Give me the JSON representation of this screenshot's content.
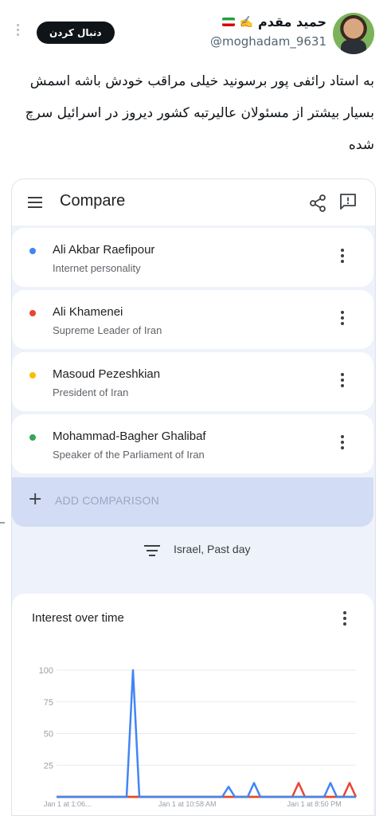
{
  "tweet": {
    "display_name": "حمید مقدم",
    "name_emoji": "✍️",
    "handle": "@moghadam_9631",
    "follow_label": "دنبال کردن",
    "text": "به استاد رائفی پور برسونید خیلی مراقب خودش باشه اسمش بسیار بیشتر از مسئولان عالیرتبه کشور دیروز در اسرائیل سرچ شده"
  },
  "trends": {
    "title": "Compare",
    "terms": [
      {
        "name": "Ali Akbar Raefipour",
        "subtitle": "Internet personality",
        "color": "#4285f4"
      },
      {
        "name": "Ali Khamenei",
        "subtitle": "Supreme Leader of Iran",
        "color": "#ea4335"
      },
      {
        "name": "Masoud Pezeshkian",
        "subtitle": "President of Iran",
        "color": "#fbbc04"
      },
      {
        "name": "Mohammad-Bagher Ghalibaf",
        "subtitle": "Speaker of the Parliament of Iran",
        "color": "#34a853"
      }
    ],
    "add_comparison_label": "ADD COMPARISON",
    "filter_label": "Israel, Past day"
  },
  "chart_data": {
    "type": "line",
    "title": "Interest over time",
    "xlabel": "",
    "ylabel": "",
    "ylim": [
      0,
      100
    ],
    "yticks": [
      25,
      50,
      75,
      100
    ],
    "xtick_labels": [
      "Jan 1 at 1:06...",
      "Jan 1 at 10:58 AM",
      "Jan 1 at 8:50 PM"
    ],
    "grid": true,
    "n_points": 48,
    "series": [
      {
        "name": "Ali Akbar Raefipour",
        "color": "#4285f4",
        "values": [
          0,
          0,
          0,
          0,
          0,
          0,
          0,
          0,
          0,
          0,
          0,
          0,
          100,
          0,
          0,
          0,
          0,
          0,
          0,
          0,
          0,
          0,
          0,
          0,
          0,
          0,
          0,
          8,
          0,
          0,
          0,
          11,
          0,
          0,
          0,
          0,
          0,
          0,
          0,
          0,
          0,
          0,
          0,
          11,
          0,
          0,
          0,
          0
        ]
      },
      {
        "name": "Ali Khamenei",
        "color": "#ea4335",
        "values": [
          0,
          0,
          0,
          0,
          0,
          0,
          0,
          0,
          0,
          0,
          0,
          0,
          0,
          0,
          0,
          0,
          0,
          0,
          0,
          0,
          0,
          0,
          0,
          0,
          0,
          0,
          0,
          0,
          0,
          0,
          0,
          0,
          0,
          0,
          0,
          0,
          0,
          0,
          11,
          0,
          0,
          0,
          0,
          0,
          0,
          0,
          11,
          0
        ]
      },
      {
        "name": "Masoud Pezeshkian",
        "color": "#fbbc04",
        "values": [
          0,
          0,
          0,
          0,
          0,
          0,
          0,
          0,
          0,
          0,
          0,
          0,
          0,
          0,
          0,
          0,
          0,
          0,
          0,
          0,
          0,
          0,
          0,
          0,
          0,
          0,
          0,
          0,
          0,
          0,
          0,
          0,
          0,
          0,
          0,
          0,
          0,
          0,
          0,
          0,
          0,
          0,
          0,
          0,
          0,
          0,
          0,
          0
        ]
      },
      {
        "name": "Mohammad-Bagher Ghalibaf",
        "color": "#34a853",
        "values": [
          0,
          0,
          0,
          0,
          0,
          0,
          0,
          0,
          0,
          0,
          0,
          0,
          0,
          0,
          0,
          0,
          0,
          0,
          0,
          0,
          0,
          0,
          0,
          0,
          0,
          0,
          0,
          0,
          0,
          0,
          0,
          0,
          0,
          0,
          0,
          0,
          0,
          0,
          0,
          0,
          0,
          0,
          0,
          0,
          0,
          0,
          0,
          0
        ]
      }
    ]
  }
}
